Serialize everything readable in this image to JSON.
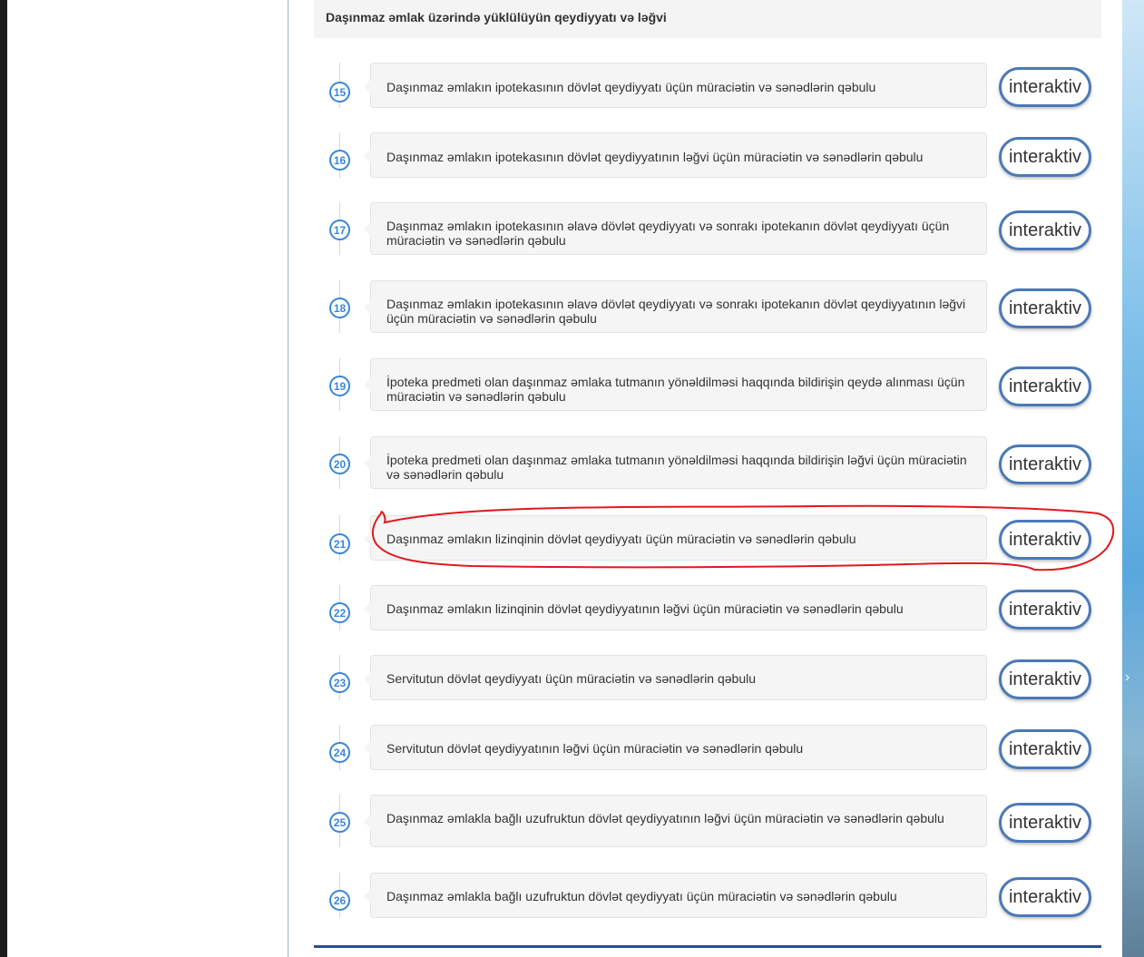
{
  "section": {
    "title": "Daşınmaz əmlak üzərində yüklülüyün qeydiyyatı və ləğvi"
  },
  "services": [
    {
      "number": "15",
      "text": "Daşınmaz əmlakın ipotekasının dövlət qeydiyyatı üçün müraciətin və sənədlərin qəbulu",
      "button": "interaktiv"
    },
    {
      "number": "16",
      "text": "Daşınmaz əmlakın ipotekasının dövlət qeydiyyatının ləğvi üçün müraciətin və sənədlərin qəbulu",
      "button": "interaktiv"
    },
    {
      "number": "17",
      "text": "Daşınmaz əmlakın ipotekasının əlavə dövlət qeydiyyatı və sonrakı ipotekanın dövlət qeydiyyatı üçün müraciətin və sənədlərin qəbulu",
      "button": "interaktiv"
    },
    {
      "number": "18",
      "text": "Daşınmaz əmlakın ipotekasının əlavə dövlət qeydiyyatı və sonrakı ipotekanın dövlət qeydiyyatının ləğvi üçün müraciətin və sənədlərin qəbulu",
      "button": "interaktiv"
    },
    {
      "number": "19",
      "text": "İpoteka predmeti olan daşınmaz əmlaka tutmanın yönəldilməsi haqqında bildirişin qeydə alınması üçün müraciətin və sənədlərin qəbulu",
      "button": "interaktiv"
    },
    {
      "number": "20",
      "text": "İpoteka predmeti olan daşınmaz əmlaka tutmanın yönəldilməsi haqqında bildirişin ləğvi üçün müraciətin və sənədlərin qəbulu",
      "button": "interaktiv"
    },
    {
      "number": "21",
      "text": "Daşınmaz əmlakın lizinqinin dövlət qeydiyyatı üçün müraciətin və sənədlərin qəbulu",
      "button": "interaktiv"
    },
    {
      "number": "22",
      "text": "Daşınmaz əmlakın lizinqinin dövlət qeydiyyatının ləğvi üçün müraciətin və sənədlərin qəbulu",
      "button": "interaktiv"
    },
    {
      "number": "23",
      "text": "Servitutun dövlət qeydiyyatı üçün müraciətin və sənədlərin qəbulu",
      "button": "interaktiv"
    },
    {
      "number": "24",
      "text": "Servitutun dövlət qeydiyyatının ləğvi üçün müraciətin və sənədlərin qəbulu",
      "button": "interaktiv"
    },
    {
      "number": "25",
      "text": "Daşınmaz əmlakla bağlı uzufruktun dövlət qeydiyyatının ləğvi üçün müraciətin və sənədlərin qəbulu",
      "button": "interaktiv"
    },
    {
      "number": "26",
      "text": "Daşınmaz əmlakla bağlı uzufruktun dövlət qeydiyyatı üçün müraciətin və sənədlərin qəbulu",
      "button": "interaktiv"
    }
  ],
  "colors": {
    "accent": "#3b86d9",
    "button_border": "#4a79b8",
    "annotation": "#e0191e"
  },
  "icons": {
    "right_strip_chevron": "chevron-right-icon"
  }
}
